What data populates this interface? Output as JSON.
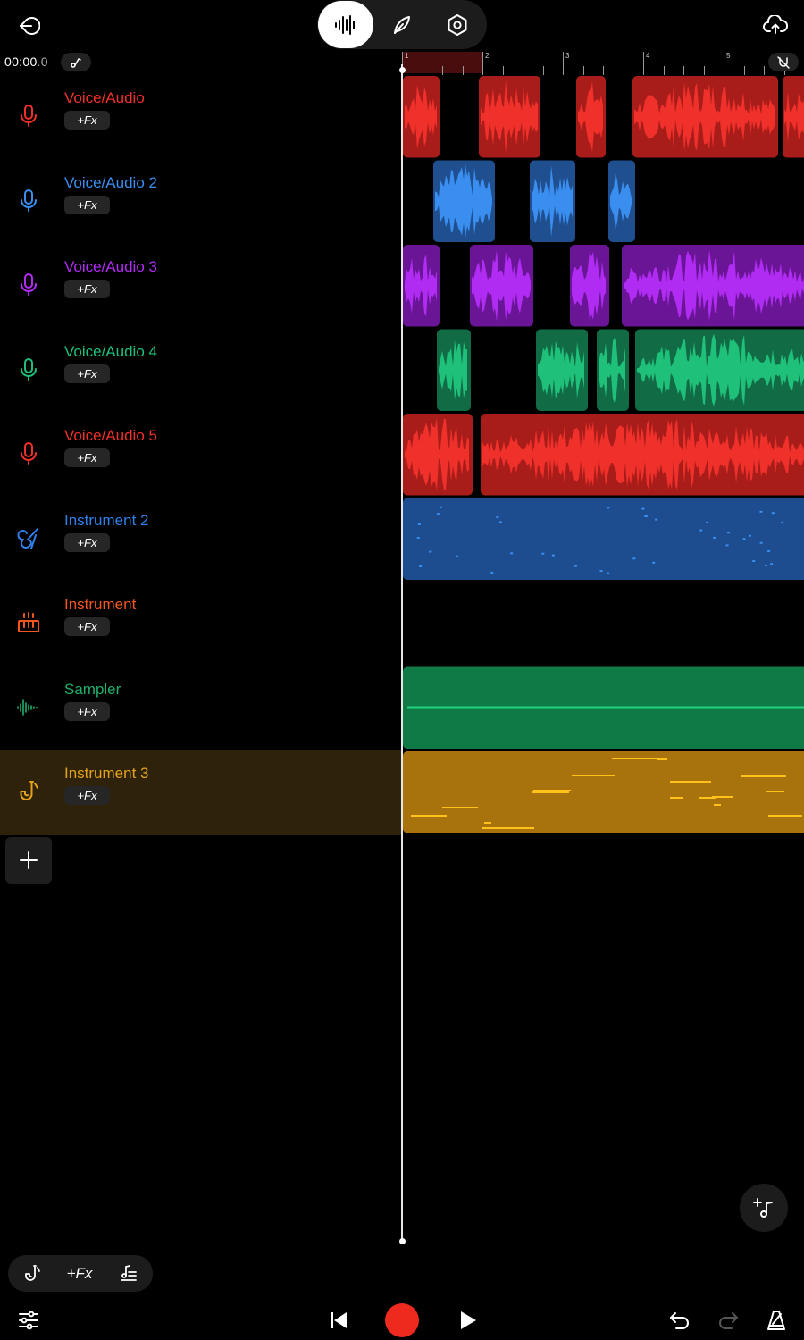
{
  "transport_time": "00:00",
  "transport_time_fraction": ".0",
  "ruler_bars": [
    "1",
    "2",
    "3",
    "4",
    "5"
  ],
  "tracks": [
    {
      "name": "Voice/Audio",
      "fx": "+Fx",
      "color": "#f0302a",
      "icon": "microphone-icon"
    },
    {
      "name": "Voice/Audio 2",
      "fx": "+Fx",
      "color": "#3a8ef0",
      "icon": "microphone-icon"
    },
    {
      "name": "Voice/Audio 3",
      "fx": "+Fx",
      "color": "#b12cf3",
      "icon": "microphone-icon"
    },
    {
      "name": "Voice/Audio 4",
      "fx": "+Fx",
      "color": "#1ec07a",
      "icon": "microphone-icon"
    },
    {
      "name": "Voice/Audio 5",
      "fx": "+Fx",
      "color": "#f0302a",
      "icon": "microphone-icon"
    },
    {
      "name": "Instrument 2",
      "fx": "+Fx",
      "color": "#2f80ea",
      "icon": "guitar-icon"
    },
    {
      "name": "Instrument",
      "fx": "+Fx",
      "color": "#f2561f",
      "icon": "keyboard-icon"
    },
    {
      "name": "Sampler",
      "fx": "+Fx",
      "color": "#1fb06c",
      "icon": "sampler-waveform-icon"
    },
    {
      "name": "Instrument 3",
      "fx": "+Fx",
      "color": "#e3a21a",
      "icon": "saxophone-icon"
    }
  ],
  "selected_track": "Instrument 3",
  "bottom_toolbar": {
    "fx_label": "+Fx"
  },
  "colors": {
    "red": "#f0302a",
    "blue": "#3a8ef0",
    "purple": "#b12cf3",
    "green": "#1ec07a",
    "instrument_blue": "#1d4d8f",
    "sampler_green": "#0f7a45",
    "gold": "#a8720c",
    "record": "#ee2a1f"
  }
}
